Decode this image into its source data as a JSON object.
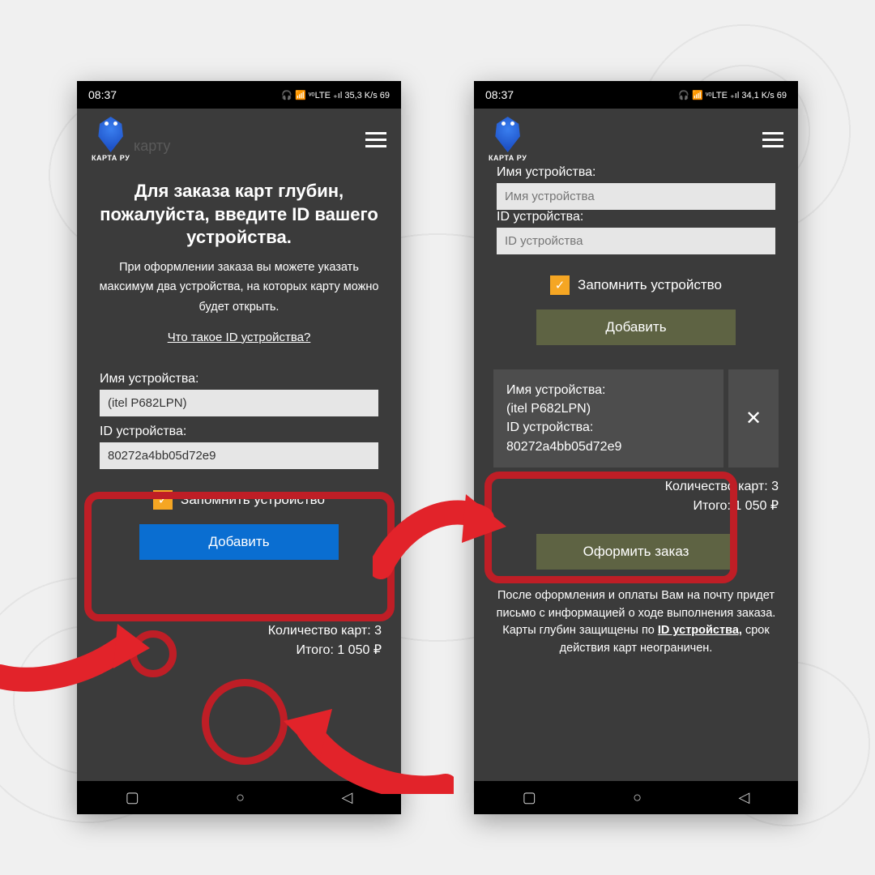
{
  "status": {
    "time": "08:37",
    "icons_left": "🎧 📶 ᵛᵒLTE ₊ıl 35,3 K/s  69",
    "icons_right": "🎧 📶 ᵛᵒLTE ₊ıl 34,1 K/s  69"
  },
  "logo_text": "КАРТА РУ",
  "bg_word": "карту",
  "left": {
    "title": "Для заказа карт глубин, пожалуйста, введите ID вашего устройства.",
    "subtitle": "При оформлении заказа вы можете указать максимум два устройства, на которых карту можно будет открыть.",
    "help_link": "Что такое ID устройства?",
    "name_label": "Имя устройства:",
    "name_value": "(itel P682LPN)",
    "id_label": "ID устройства:",
    "id_value": "80272a4bb05d72e9",
    "remember": "Запомнить устройство",
    "add_btn": "Добавить",
    "count": "Количество карт: 3",
    "total": "Итого: 1 050 ₽"
  },
  "right": {
    "name_label": "Имя устройства:",
    "name_placeholder": "Имя устройства",
    "id_label": "ID устройства:",
    "id_placeholder": "ID устройства",
    "remember": "Запомнить устройство",
    "add_btn": "Добавить",
    "card": {
      "name_label": "Имя устройства:",
      "name_value": "(itel P682LPN)",
      "id_label": "ID устройства:",
      "id_value": "80272a4bb05d72e9"
    },
    "count": "Количество карт: 3",
    "total": "Итого: 1 050 ₽",
    "order_btn": "Оформить заказ",
    "footnote_a": "После оформления и оплаты Вам на почту придет письмо с информацией о ходе выполнения заказа. Карты глубин защищены по ",
    "footnote_link": "ID устройства,",
    "footnote_b": " срок действия карт неограничен."
  }
}
